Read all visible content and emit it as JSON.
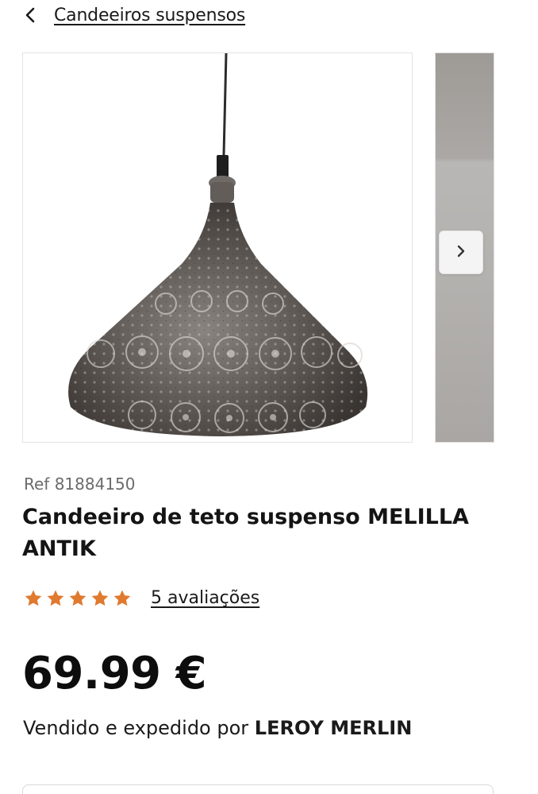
{
  "breadcrumb": {
    "back_icon": "chevron-left-icon",
    "label": "Candeeiros suspensos"
  },
  "gallery": {
    "next_icon": "chevron-right-icon"
  },
  "product": {
    "ref": "Ref 81884150",
    "title": "Candeeiro de teto suspenso MELILLA ANTIK",
    "rating": 5,
    "rating_max": 5,
    "reviews_label": "5 avaliações",
    "price": "69.99 €",
    "seller_prefix": "Vendido e expedido por ",
    "seller_name": "LEROY MERLIN"
  },
  "colors": {
    "star": "#e07a2f",
    "text": "#1a1a1a",
    "muted": "#6b6b6b"
  }
}
